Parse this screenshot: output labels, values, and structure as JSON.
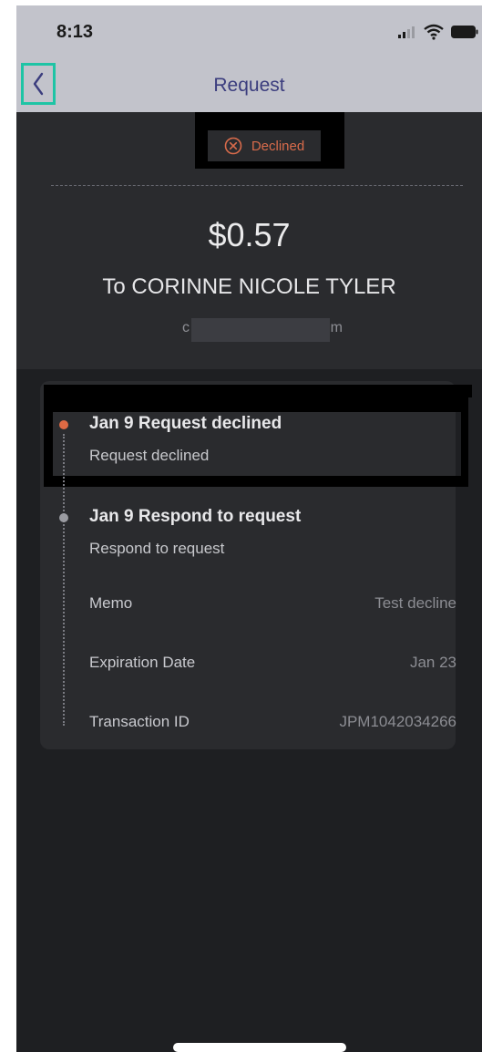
{
  "status_bar": {
    "time": "8:13"
  },
  "nav": {
    "title": "Request",
    "back_icon": "chevron-left-icon"
  },
  "status_chip": {
    "label": "Declined",
    "icon": "x-circle-icon",
    "color": "#d86b4b"
  },
  "payment": {
    "amount": "$0.57",
    "recipient": "To CORINNE NICOLE TYLER",
    "email_start": "c",
    "email_end": "m"
  },
  "timeline": [
    {
      "title": "Jan 9 Request declined",
      "subtitle": "Request declined",
      "dot_color": "#e06a44"
    },
    {
      "title": "Jan 9 Respond to request",
      "subtitle": "Respond to request",
      "dot_color": "#9a9ba1"
    }
  ],
  "details": [
    {
      "label": "Memo",
      "value": "Test decline"
    },
    {
      "label": "Expiration Date",
      "value": "Jan 23"
    },
    {
      "label": "Transaction ID",
      "value": "JPM1042034266"
    }
  ],
  "colors": {
    "accent": "#1ec4a5",
    "nav_title": "#3b3d7e",
    "background": "#1e1f22"
  }
}
